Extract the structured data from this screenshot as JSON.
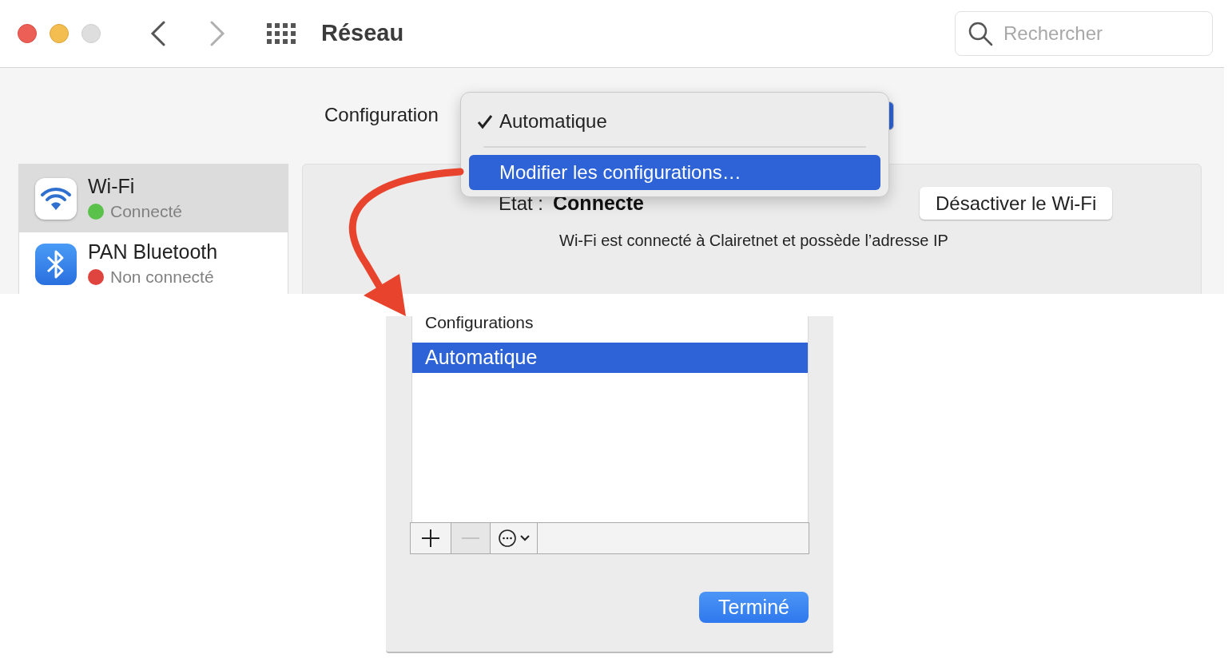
{
  "window": {
    "title": "Réseau",
    "search": {
      "placeholder": "Rechercher"
    }
  },
  "configuration": {
    "label": "Configuration",
    "menu": [
      {
        "label": "Automatique",
        "checked": true,
        "selected": false
      },
      {
        "label": "Modifier les configurations…",
        "checked": false,
        "selected": true
      }
    ]
  },
  "services": [
    {
      "kind": "wifi",
      "name": "Wi-Fi",
      "status": "Connecté",
      "color": "#5ac14a",
      "selected": true
    },
    {
      "kind": "bluetooth",
      "name": "PAN Bluetooth",
      "status": "Non connecté",
      "color": "#e0443e",
      "selected": false
    }
  ],
  "detail": {
    "state_label": "Etat :",
    "state_value": "Connecte",
    "description": "Wi-Fi est connecté à Clairetnet et possède l’adresse IP",
    "button": "Désactiver le Wi-Fi"
  },
  "sheet": {
    "heading": "Configurations",
    "items": [
      {
        "label": "Automatique",
        "selected": true
      }
    ],
    "remove_disabled": true,
    "done_button": "Terminé"
  }
}
